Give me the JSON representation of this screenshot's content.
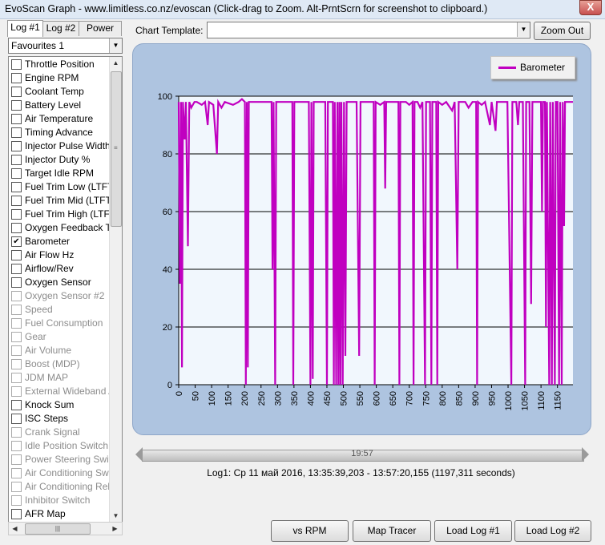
{
  "window": {
    "title": "EvoScan Graph - www.limitless.co.nz/evoscan  (Click-drag to Zoom.   Alt-PrntScrn for screenshot to clipboard.)",
    "close": "X"
  },
  "tabs": [
    {
      "label": "Log #1",
      "active": true
    },
    {
      "label": "Log #2",
      "active": false
    },
    {
      "label": "Power",
      "active": false
    }
  ],
  "favourites": {
    "selected": "Favourites 1"
  },
  "parameters": [
    {
      "label": "Throttle Position",
      "checked": false,
      "disabled": false
    },
    {
      "label": "Engine RPM",
      "checked": false,
      "disabled": false
    },
    {
      "label": "Coolant Temp",
      "checked": false,
      "disabled": false
    },
    {
      "label": "Battery Level",
      "checked": false,
      "disabled": false
    },
    {
      "label": "Air Temperature",
      "checked": false,
      "disabled": false
    },
    {
      "label": "Timing Advance",
      "checked": false,
      "disabled": false
    },
    {
      "label": "Injector Pulse Width",
      "checked": false,
      "disabled": false
    },
    {
      "label": "Injector Duty %",
      "checked": false,
      "disabled": false
    },
    {
      "label": "Target Idle RPM",
      "checked": false,
      "disabled": false
    },
    {
      "label": "Fuel Trim Low (LTFT)",
      "checked": false,
      "disabled": false
    },
    {
      "label": "Fuel Trim Mid (LTFT)",
      "checked": false,
      "disabled": false
    },
    {
      "label": "Fuel Trim High (LTFT)",
      "checked": false,
      "disabled": false
    },
    {
      "label": "Oxygen Feedback Trim",
      "checked": false,
      "disabled": false
    },
    {
      "label": "Barometer",
      "checked": true,
      "disabled": false
    },
    {
      "label": "Air Flow Hz",
      "checked": false,
      "disabled": false
    },
    {
      "label": "Airflow/Rev",
      "checked": false,
      "disabled": false
    },
    {
      "label": "Oxygen Sensor",
      "checked": false,
      "disabled": false
    },
    {
      "label": "Oxygen Sensor #2",
      "checked": false,
      "disabled": true
    },
    {
      "label": "Speed",
      "checked": false,
      "disabled": true
    },
    {
      "label": "Fuel Consumption",
      "checked": false,
      "disabled": true
    },
    {
      "label": "Gear",
      "checked": false,
      "disabled": true
    },
    {
      "label": "Air Volume",
      "checked": false,
      "disabled": true
    },
    {
      "label": "Boost (MDP)",
      "checked": false,
      "disabled": true
    },
    {
      "label": "JDM MAP",
      "checked": false,
      "disabled": true
    },
    {
      "label": "External Wideband A/F",
      "checked": false,
      "disabled": true
    },
    {
      "label": "Knock Sum",
      "checked": false,
      "disabled": false
    },
    {
      "label": "ISC Steps",
      "checked": false,
      "disabled": false
    },
    {
      "label": "Crank Signal",
      "checked": false,
      "disabled": true
    },
    {
      "label": "Idle Position Switch",
      "checked": false,
      "disabled": true
    },
    {
      "label": "Power Steering Switch",
      "checked": false,
      "disabled": true
    },
    {
      "label": "Air Conditioning Switch",
      "checked": false,
      "disabled": true
    },
    {
      "label": "Air Conditioning Relay",
      "checked": false,
      "disabled": true
    },
    {
      "label": "Inhibitor Switch",
      "checked": false,
      "disabled": true
    },
    {
      "label": "AFR Map",
      "checked": false,
      "disabled": false
    }
  ],
  "chart_template": {
    "label": "Chart Template:",
    "value": ""
  },
  "zoom_out": "Zoom Out",
  "checkmark": "✔",
  "time_slider": {
    "label": "19:57"
  },
  "log_info": "Log1: Ср 11 май 2016,  13:35:39,203 - 13:57:20,155 (1197,311 seconds)",
  "buttons": {
    "vs_rpm": "vs RPM",
    "map_tracer": "Map Tracer",
    "load_log1": "Load Log #1",
    "load_log2": "Load Log #2"
  },
  "colors": {
    "series": "#c000c0",
    "plot_bg": "#f1f7fd",
    "panel_bg": "#aec4e0"
  },
  "chart_data": {
    "type": "line",
    "title": "",
    "xlabel": "",
    "ylabel": "",
    "xlim": [
      0,
      1197
    ],
    "ylim": [
      0,
      100
    ],
    "xticks": [
      0,
      50,
      100,
      150,
      200,
      250,
      300,
      350,
      400,
      450,
      500,
      550,
      600,
      650,
      700,
      750,
      800,
      850,
      900,
      950,
      1000,
      1050,
      1100,
      1150
    ],
    "yticks": [
      0,
      20,
      40,
      60,
      80,
      100
    ],
    "grid": "horizontal",
    "legend_position": "top-right",
    "series": [
      {
        "name": "Barometer",
        "color": "#c000c0",
        "baseline": 98,
        "points": [
          [
            0,
            98
          ],
          [
            4,
            35
          ],
          [
            7,
            98
          ],
          [
            10,
            6
          ],
          [
            13,
            98
          ],
          [
            18,
            85
          ],
          [
            22,
            98
          ],
          [
            28,
            48
          ],
          [
            32,
            98
          ],
          [
            38,
            96
          ],
          [
            48,
            98
          ],
          [
            55,
            98
          ],
          [
            70,
            97
          ],
          [
            80,
            98
          ],
          [
            88,
            90
          ],
          [
            92,
            98
          ],
          [
            105,
            97
          ],
          [
            116,
            80
          ],
          [
            120,
            98
          ],
          [
            130,
            96
          ],
          [
            140,
            98
          ],
          [
            165,
            97
          ],
          [
            182,
            98
          ],
          [
            192,
            99
          ],
          [
            201,
            98
          ],
          [
            204,
            0
          ],
          [
            207,
            98
          ],
          [
            210,
            6
          ],
          [
            213,
            98
          ],
          [
            220,
            98
          ],
          [
            250,
            98
          ],
          [
            282,
            98
          ],
          [
            285,
            40
          ],
          [
            288,
            98
          ],
          [
            293,
            0
          ],
          [
            296,
            98
          ],
          [
            300,
            98
          ],
          [
            320,
            98
          ],
          [
            345,
            98
          ],
          [
            348,
            0
          ],
          [
            351,
            98
          ],
          [
            380,
            98
          ],
          [
            395,
            98
          ],
          [
            400,
            0
          ],
          [
            403,
            98
          ],
          [
            407,
            2
          ],
          [
            410,
            98
          ],
          [
            420,
            98
          ],
          [
            445,
            98
          ],
          [
            450,
            0
          ],
          [
            453,
            98
          ],
          [
            468,
            98
          ],
          [
            471,
            0
          ],
          [
            474,
            98
          ],
          [
            478,
            0
          ],
          [
            482,
            98
          ],
          [
            485,
            0
          ],
          [
            488,
            98
          ],
          [
            491,
            0
          ],
          [
            494,
            98
          ],
          [
            498,
            0
          ],
          [
            502,
            98
          ],
          [
            506,
            10
          ],
          [
            510,
            98
          ],
          [
            520,
            98
          ],
          [
            540,
            98
          ],
          [
            548,
            10
          ],
          [
            552,
            98
          ],
          [
            570,
            98
          ],
          [
            592,
            98
          ],
          [
            595,
            0
          ],
          [
            598,
            98
          ],
          [
            612,
            97
          ],
          [
            624,
            98
          ],
          [
            627,
            68
          ],
          [
            630,
            98
          ],
          [
            650,
            98
          ],
          [
            655,
            98
          ],
          [
            667,
            98
          ],
          [
            670,
            0
          ],
          [
            673,
            98
          ],
          [
            690,
            98
          ],
          [
            700,
            97
          ],
          [
            710,
            98
          ],
          [
            713,
            0
          ],
          [
            716,
            98
          ],
          [
            725,
            98
          ],
          [
            733,
            96
          ],
          [
            740,
            98
          ],
          [
            748,
            0
          ],
          [
            751,
            98
          ],
          [
            763,
            98
          ],
          [
            767,
            0
          ],
          [
            770,
            98
          ],
          [
            782,
            98
          ],
          [
            785,
            0
          ],
          [
            788,
            98
          ],
          [
            800,
            97
          ],
          [
            812,
            98
          ],
          [
            830,
            95
          ],
          [
            838,
            98
          ],
          [
            846,
            40
          ],
          [
            850,
            98
          ],
          [
            870,
            98
          ],
          [
            880,
            96
          ],
          [
            892,
            98
          ],
          [
            903,
            98
          ],
          [
            906,
            0
          ],
          [
            909,
            98
          ],
          [
            920,
            97
          ],
          [
            930,
            98
          ],
          [
            945,
            90
          ],
          [
            950,
            98
          ],
          [
            962,
            88
          ],
          [
            966,
            98
          ],
          [
            980,
            98
          ],
          [
            998,
            98
          ],
          [
            1010,
            0
          ],
          [
            1013,
            98
          ],
          [
            1025,
            98
          ],
          [
            1030,
            90
          ],
          [
            1034,
            98
          ],
          [
            1045,
            98
          ],
          [
            1052,
            0
          ],
          [
            1055,
            98
          ],
          [
            1065,
            98
          ],
          [
            1070,
            28
          ],
          [
            1074,
            98
          ],
          [
            1085,
            98
          ],
          [
            1100,
            98
          ],
          [
            1103,
            60
          ],
          [
            1106,
            98
          ],
          [
            1112,
            98
          ],
          [
            1115,
            20
          ],
          [
            1118,
            98
          ],
          [
            1125,
            0
          ],
          [
            1128,
            98
          ],
          [
            1133,
            0
          ],
          [
            1136,
            98
          ],
          [
            1142,
            0
          ],
          [
            1145,
            98
          ],
          [
            1150,
            98
          ],
          [
            1155,
            0
          ],
          [
            1158,
            98
          ],
          [
            1163,
            0
          ],
          [
            1166,
            98
          ],
          [
            1170,
            55
          ],
          [
            1173,
            98
          ],
          [
            1180,
            98
          ],
          [
            1197,
            98
          ]
        ]
      }
    ]
  }
}
